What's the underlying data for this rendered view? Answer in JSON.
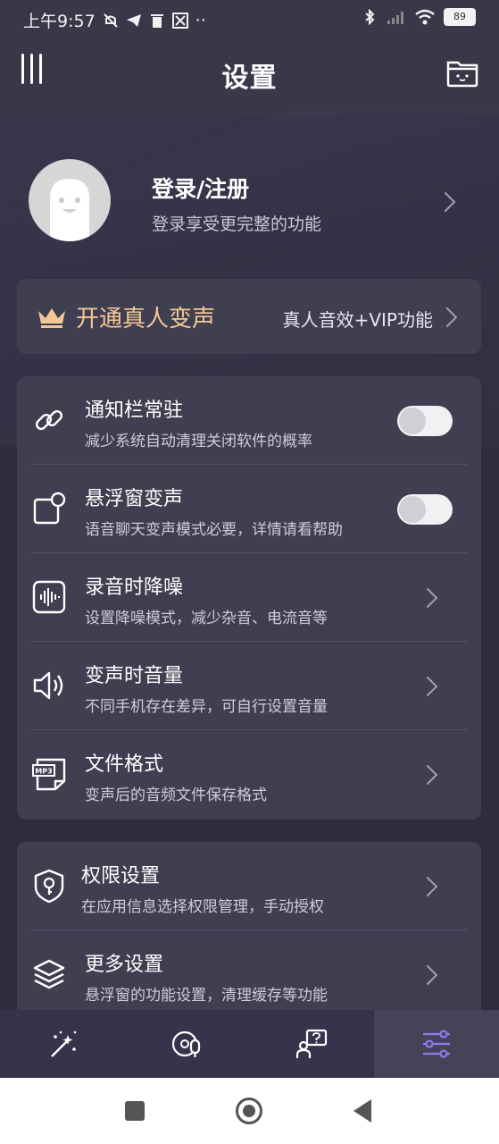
{
  "status_bar": {
    "time": "上午9:57",
    "dots": "··",
    "battery": "89"
  },
  "header": {
    "title": "设置"
  },
  "profile": {
    "title": "登录/注册",
    "subtitle": "登录享受更完整的功能"
  },
  "vip": {
    "label": "开通真人变声",
    "right_text": "真人音效+VIP功能"
  },
  "group1": [
    {
      "title": "通知栏常驻",
      "subtitle": "减少系统自动清理关闭软件的概率",
      "control": "toggle",
      "on": false,
      "icon": "link-icon"
    },
    {
      "title": "悬浮窗变声",
      "subtitle": "语音聊天变声模式必要，详情请看帮助",
      "control": "toggle",
      "on": false,
      "icon": "floating-window-icon"
    },
    {
      "title": "录音时降噪",
      "subtitle": "设置降噪模式，减少杂音、电流音等",
      "control": "chevron",
      "icon": "waveform-icon"
    },
    {
      "title": "变声时音量",
      "subtitle": "不同手机存在差异，可自行设置音量",
      "control": "chevron",
      "icon": "speaker-icon"
    },
    {
      "title": "文件格式",
      "subtitle": "变声后的音频文件保存格式",
      "control": "chevron",
      "icon": "mp3-file-icon",
      "icon_text": "MP3"
    }
  ],
  "group2": [
    {
      "title": "权限设置",
      "subtitle": "在应用信息选择权限管理，手动授权",
      "control": "chevron",
      "icon": "shield-key-icon"
    },
    {
      "title": "更多设置",
      "subtitle": "悬浮窗的功能设置，清理缓存等功能",
      "control": "chevron",
      "icon": "layers-icon"
    }
  ],
  "tabs": [
    {
      "icon": "magic-wand-icon",
      "active": false
    },
    {
      "icon": "voice-disc-icon",
      "active": false
    },
    {
      "icon": "help-person-icon",
      "active": false
    },
    {
      "icon": "settings-sliders-icon",
      "active": true
    }
  ],
  "colors": {
    "background": "#2f2d3d",
    "card": "#403e51",
    "vip_gold": "#f4c996",
    "accent_purple": "#8b7bf0"
  }
}
